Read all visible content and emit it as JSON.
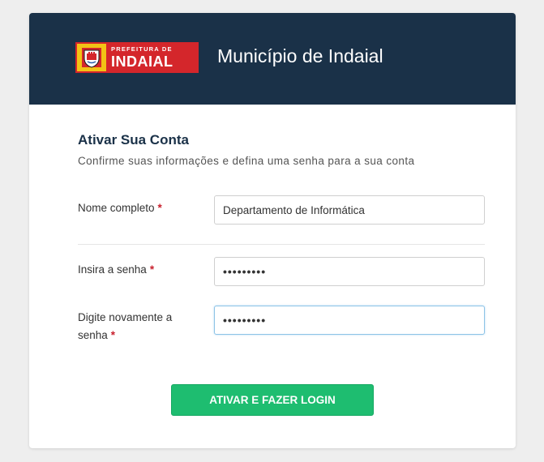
{
  "header": {
    "logo_small_text": "PREFEITURA DE",
    "logo_big_text": "INDAIAL",
    "title": "Município de Indaial"
  },
  "form": {
    "title": "Ativar Sua Conta",
    "subtitle": "Confirme suas informações e defina uma senha para a sua conta",
    "fields": {
      "name": {
        "label": "Nome completo",
        "required_mark": "*",
        "value": "Departamento de Informática"
      },
      "password": {
        "label": "Insira a senha",
        "required_mark": "*",
        "value": "123456789"
      },
      "password_confirm": {
        "label_line1": "Digite novamente a",
        "label_line2": "senha",
        "required_mark": "*",
        "value": "123456789"
      }
    },
    "submit_label": "ATIVAR E FAZER LOGIN"
  },
  "colors": {
    "header_bg": "#1a3148",
    "accent_green": "#1ebd70",
    "required_red": "#c8202d",
    "logo_red": "#d4262b",
    "logo_yellow": "#f2c315"
  }
}
